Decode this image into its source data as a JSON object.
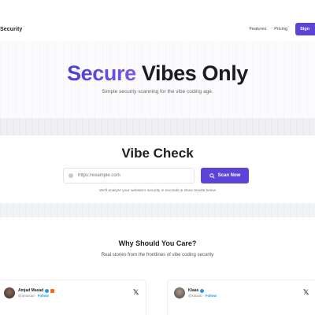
{
  "header": {
    "brand": "Security",
    "nav": [
      "Features",
      "Pricing"
    ],
    "cta": "Sign"
  },
  "hero": {
    "title_accent": "Secure",
    "title_rest": " Vibes Only",
    "subtitle": "Simple security scanning for the vibe coding age."
  },
  "vibe_check": {
    "title": "Vibe Check",
    "url_placeholder": "https://example.com",
    "scan_label": "Scan Now",
    "hint": "We'll analyze your website's security in seconds & show results below"
  },
  "why": {
    "title": "Why Should You Care?",
    "subtitle": "Real stories from the frontlines of vibe coding security"
  },
  "tweets": [
    {
      "name": "Amjad Masad",
      "handle": "@amasad",
      "follow": "Follow"
    },
    {
      "name": "Klaas",
      "handle": "@klaasb",
      "follow": "Follow"
    }
  ],
  "colors": {
    "accent": "#5b45d8"
  }
}
